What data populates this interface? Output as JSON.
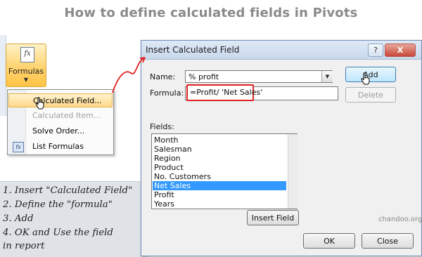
{
  "page": {
    "title": "How to define calculated fields in Pivots"
  },
  "ribbon": {
    "button_label": "Formulas"
  },
  "menu": {
    "items": [
      {
        "label": "Calculated Field...",
        "state": "highlighted"
      },
      {
        "label": "Calculated Item...",
        "state": "disabled"
      },
      {
        "label": "Solve Order...",
        "state": "normal"
      },
      {
        "label": "List Formulas",
        "state": "normal"
      }
    ]
  },
  "instructions": {
    "lines": [
      "1. Insert \"Calculated Field\"",
      "2. Define the \"formula\"",
      "3. Add",
      "4. OK and Use the field",
      "in report"
    ]
  },
  "dialog": {
    "title": "Insert Calculated Field",
    "help_label": "?",
    "close_label": "X",
    "name_label": "Name:",
    "name_value": "% profit",
    "formula_label": "Formula:",
    "formula_value": "=Profit/ 'Net Sales'",
    "add_label": "Add",
    "delete_label": "Delete",
    "fields_label": "Fields:",
    "fields": [
      "Month",
      "Salesman",
      "Region",
      "Product",
      "No. Customers",
      "Net Sales",
      "Profit",
      "Years"
    ],
    "selected_field": "Net Sales",
    "insert_field_label": "Insert Field",
    "ok_label": "OK",
    "close_button_label": "Close"
  },
  "watermark": "chandoo.org",
  "colors": {
    "highlight_red": "#e02020",
    "selection_blue": "#3399ff",
    "ribbon_orange": "#ffc447",
    "title_gray": "#8a8a8a",
    "instructions_bg": "#dfe2e6"
  }
}
